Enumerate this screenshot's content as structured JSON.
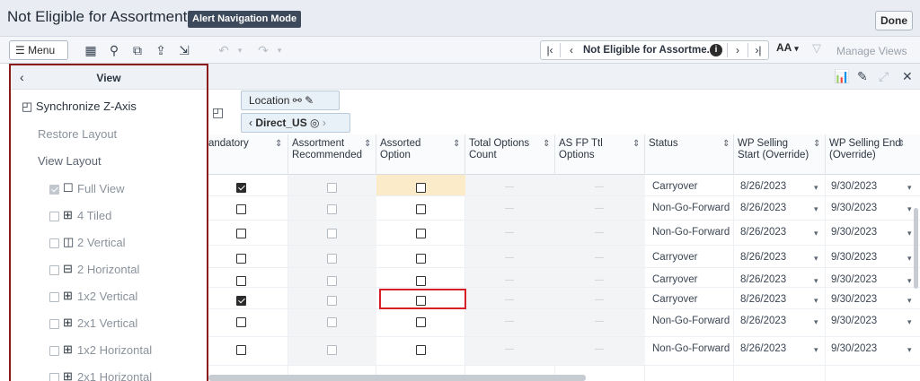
{
  "header": {
    "title": "Not Eligible for Assortment",
    "alert_badge": "Alert Navigation Mode",
    "done_label": "Done"
  },
  "toolbar": {
    "menu_label": "Menu",
    "nav_title": "Not Eligible for Assortme...",
    "font_label": "AA",
    "manage_views": "Manage Views"
  },
  "tiles": {
    "location": "Location",
    "direct": "Direct_US"
  },
  "panel": {
    "title": "View",
    "synchronize": "Synchronize Z-Axis",
    "restore_layout": "Restore Layout",
    "view_layout": "View Layout",
    "layouts": [
      {
        "label": "Full View",
        "checked": true
      },
      {
        "label": "4 Tiled",
        "checked": false
      },
      {
        "label": "2 Vertical",
        "checked": false
      },
      {
        "label": "2 Horizontal",
        "checked": false
      },
      {
        "label": "1x2 Vertical",
        "checked": false
      },
      {
        "label": "2x1 Vertical",
        "checked": false
      },
      {
        "label": "1x2 Horizontal",
        "checked": false
      },
      {
        "label": "2x1 Horizontal",
        "checked": false
      }
    ]
  },
  "columns": [
    "andatory",
    "Assortment Recommended",
    "Assorted Option",
    "Total Options Count",
    "AS FP Ttl Options",
    "Status",
    "WP Selling Start (Override)",
    "WP Selling End (Override)"
  ],
  "rows": [
    {
      "mandatory": true,
      "assorted": false,
      "status": "Carryover",
      "start": "8/26/2023",
      "end": "9/30/2023"
    },
    {
      "mandatory": false,
      "assorted": false,
      "status": "Non-Go-Forward",
      "start": "8/26/2023",
      "end": "9/30/2023"
    },
    {
      "mandatory": false,
      "assorted": false,
      "status": "Non-Go-Forward",
      "start": "8/26/2023",
      "end": "9/30/2023"
    },
    {
      "mandatory": false,
      "assorted": false,
      "status": "Carryover",
      "start": "8/26/2023",
      "end": "9/30/2023"
    },
    {
      "mandatory": false,
      "assorted": false,
      "status": "Carryover",
      "start": "8/26/2023",
      "end": "9/30/2023"
    },
    {
      "mandatory": true,
      "assorted": false,
      "status": "Carryover",
      "start": "8/26/2023",
      "end": "9/30/2023"
    },
    {
      "mandatory": false,
      "assorted": false,
      "status": "Non-Go-Forward",
      "start": "8/26/2023",
      "end": "9/30/2023"
    },
    {
      "mandatory": false,
      "assorted": false,
      "status": "Non-Go-Forward",
      "start": "8/26/2023",
      "end": "9/30/2023"
    }
  ],
  "colors": {
    "highlight": "#fcebc9",
    "selection_border": "#d61f26",
    "panel_border": "#8b1a1a"
  }
}
